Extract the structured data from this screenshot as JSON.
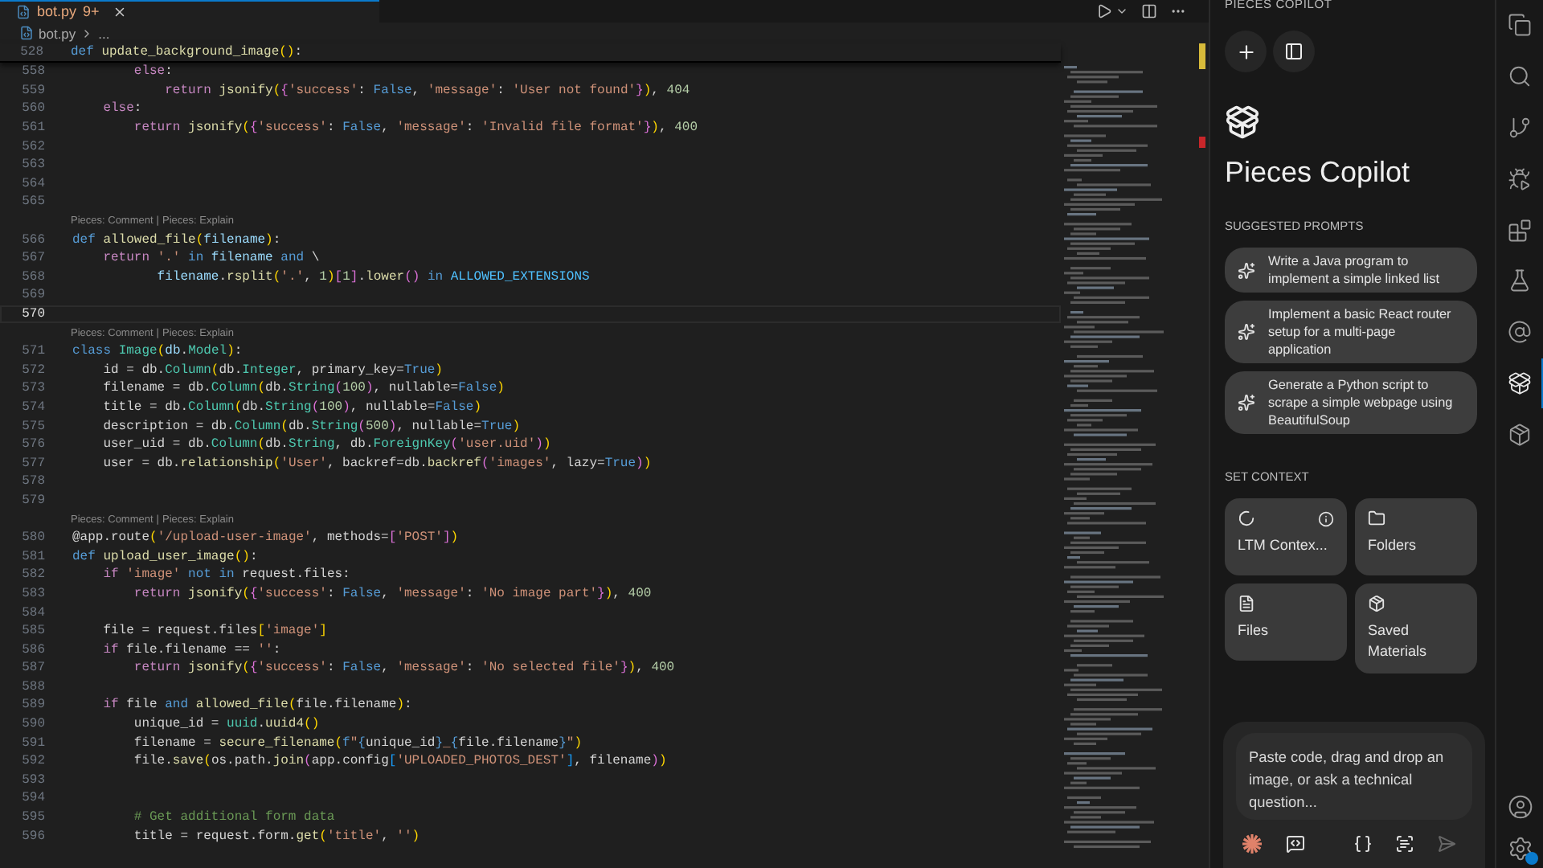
{
  "tab": {
    "label": "bot.py",
    "badge": "9+",
    "selected": true
  },
  "breadcrumb": {
    "file": "bot.py",
    "rest": "..."
  },
  "editor": {
    "sticky": {
      "number": "528",
      "tokens": [
        {
          "kind": "kw",
          "text": "def"
        },
        {
          "kind": "fn",
          "text": " update_background_image"
        },
        {
          "kind": "br",
          "text": "()"
        },
        {
          "kind": "p",
          "text": ":"
        }
      ]
    },
    "lines": [
      {
        "kind": "code",
        "number": "558",
        "current": false,
        "tokens": [
          {
            "kind": "ctl",
            "text": "        else"
          },
          {
            "kind": "p",
            "text": ":"
          }
        ]
      },
      {
        "kind": "code",
        "number": "559",
        "current": false,
        "tokens": [
          {
            "kind": "ctl",
            "text": "            return"
          },
          {
            "kind": "fn",
            "text": " jsonify"
          },
          {
            "kind": "br",
            "text": "("
          },
          {
            "kind": "br2",
            "text": "{"
          },
          {
            "kind": "str",
            "text": "'success'"
          },
          {
            "kind": "p",
            "text": ": "
          },
          {
            "kind": "kw",
            "text": "False"
          },
          {
            "kind": "p",
            "text": ", "
          },
          {
            "kind": "str",
            "text": "'message'"
          },
          {
            "kind": "p",
            "text": ": "
          },
          {
            "kind": "str",
            "text": "'User not found'"
          },
          {
            "kind": "br2",
            "text": "}"
          },
          {
            "kind": "br",
            "text": ")"
          },
          {
            "kind": "p",
            "text": ", "
          },
          {
            "kind": "num",
            "text": "404"
          }
        ]
      },
      {
        "kind": "code",
        "number": "560",
        "current": false,
        "tokens": [
          {
            "kind": "ctl",
            "text": "    else"
          },
          {
            "kind": "p",
            "text": ":"
          }
        ]
      },
      {
        "kind": "code",
        "number": "561",
        "current": false,
        "tokens": [
          {
            "kind": "ctl",
            "text": "        return"
          },
          {
            "kind": "fn",
            "text": " jsonify"
          },
          {
            "kind": "br",
            "text": "("
          },
          {
            "kind": "br2",
            "text": "{"
          },
          {
            "kind": "str",
            "text": "'success'"
          },
          {
            "kind": "p",
            "text": ": "
          },
          {
            "kind": "kw",
            "text": "False"
          },
          {
            "kind": "p",
            "text": ", "
          },
          {
            "kind": "str",
            "text": "'message'"
          },
          {
            "kind": "p",
            "text": ": "
          },
          {
            "kind": "str",
            "text": "'Invalid file format'"
          },
          {
            "kind": "br2",
            "text": "}"
          },
          {
            "kind": "br",
            "text": ")"
          },
          {
            "kind": "p",
            "text": ", "
          },
          {
            "kind": "num",
            "text": "400"
          }
        ]
      },
      {
        "kind": "code",
        "number": "562",
        "current": false
      },
      {
        "kind": "code",
        "number": "563",
        "current": false
      },
      {
        "kind": "code",
        "number": "564",
        "current": false
      },
      {
        "kind": "code",
        "number": "565",
        "current": false
      },
      {
        "kind": "lens",
        "links": [
          "Pieces: Comment",
          "Pieces: Explain"
        ],
        "separator": "|"
      },
      {
        "kind": "code",
        "number": "566",
        "current": false,
        "tokens": [
          {
            "kind": "kw",
            "text": "def"
          },
          {
            "kind": "fn",
            "text": " allowed_file"
          },
          {
            "kind": "br",
            "text": "("
          },
          {
            "kind": "var",
            "text": "filename"
          },
          {
            "kind": "br",
            "text": ")"
          },
          {
            "kind": "p",
            "text": ":"
          }
        ]
      },
      {
        "kind": "code",
        "number": "567",
        "current": false,
        "tokens": [
          {
            "kind": "ctl",
            "text": "    return"
          },
          {
            "kind": "str",
            "text": " '.'"
          },
          {
            "kind": "kw",
            "text": " in"
          },
          {
            "kind": "var",
            "text": " filename"
          },
          {
            "kind": "kw",
            "text": " and"
          },
          {
            "kind": "p",
            "text": " \\"
          }
        ]
      },
      {
        "kind": "code",
        "number": "568",
        "current": false,
        "tokens": [
          {
            "kind": "var",
            "text": "           filename"
          },
          {
            "kind": "p",
            "text": "."
          },
          {
            "kind": "fn",
            "text": "rsplit"
          },
          {
            "kind": "br",
            "text": "("
          },
          {
            "kind": "str",
            "text": "'.'"
          },
          {
            "kind": "p",
            "text": ", "
          },
          {
            "kind": "num",
            "text": "1"
          },
          {
            "kind": "br",
            "text": ")"
          },
          {
            "kind": "br2",
            "text": "["
          },
          {
            "kind": "num",
            "text": "1"
          },
          {
            "kind": "br2",
            "text": "]"
          },
          {
            "kind": "p",
            "text": "."
          },
          {
            "kind": "fn",
            "text": "lower"
          },
          {
            "kind": "br2",
            "text": "()"
          },
          {
            "kind": "kw",
            "text": " in"
          },
          {
            "kind": "cst",
            "text": " ALLOWED_EXTENSIONS"
          }
        ]
      },
      {
        "kind": "code",
        "number": "569",
        "current": false
      },
      {
        "kind": "code",
        "number": "570",
        "current": true
      },
      {
        "kind": "lens",
        "links": [
          "Pieces: Comment",
          "Pieces: Explain"
        ],
        "separator": "|"
      },
      {
        "kind": "code",
        "number": "571",
        "current": false,
        "tokens": [
          {
            "kind": "kw",
            "text": "class"
          },
          {
            "kind": "cls",
            "text": " Image"
          },
          {
            "kind": "br",
            "text": "("
          },
          {
            "kind": "var",
            "text": "db"
          },
          {
            "kind": "p",
            "text": "."
          },
          {
            "kind": "cls",
            "text": "Model"
          },
          {
            "kind": "br",
            "text": ")"
          },
          {
            "kind": "p",
            "text": ":"
          }
        ]
      },
      {
        "kind": "code",
        "number": "572",
        "current": false,
        "tokens": [
          {
            "kind": "p",
            "text": "    id = db."
          },
          {
            "kind": "cls",
            "text": "Column"
          },
          {
            "kind": "br",
            "text": "("
          },
          {
            "kind": "p",
            "text": "db."
          },
          {
            "kind": "cls",
            "text": "Integer"
          },
          {
            "kind": "p",
            "text": ", primary_key="
          },
          {
            "kind": "kw",
            "text": "True"
          },
          {
            "kind": "br",
            "text": ")"
          }
        ]
      },
      {
        "kind": "code",
        "number": "573",
        "current": false,
        "tokens": [
          {
            "kind": "p",
            "text": "    filename = db."
          },
          {
            "kind": "cls",
            "text": "Column"
          },
          {
            "kind": "br",
            "text": "("
          },
          {
            "kind": "p",
            "text": "db."
          },
          {
            "kind": "cls",
            "text": "String"
          },
          {
            "kind": "br2",
            "text": "("
          },
          {
            "kind": "num",
            "text": "100"
          },
          {
            "kind": "br2",
            "text": ")"
          },
          {
            "kind": "p",
            "text": ", nullable="
          },
          {
            "kind": "kw",
            "text": "False"
          },
          {
            "kind": "br",
            "text": ")"
          }
        ]
      },
      {
        "kind": "code",
        "number": "574",
        "current": false,
        "tokens": [
          {
            "kind": "p",
            "text": "    title = db."
          },
          {
            "kind": "cls",
            "text": "Column"
          },
          {
            "kind": "br",
            "text": "("
          },
          {
            "kind": "p",
            "text": "db."
          },
          {
            "kind": "cls",
            "text": "String"
          },
          {
            "kind": "br2",
            "text": "("
          },
          {
            "kind": "num",
            "text": "100"
          },
          {
            "kind": "br2",
            "text": ")"
          },
          {
            "kind": "p",
            "text": ", nullable="
          },
          {
            "kind": "kw",
            "text": "False"
          },
          {
            "kind": "br",
            "text": ")"
          }
        ]
      },
      {
        "kind": "code",
        "number": "575",
        "current": false,
        "tokens": [
          {
            "kind": "p",
            "text": "    description = db."
          },
          {
            "kind": "cls",
            "text": "Column"
          },
          {
            "kind": "br",
            "text": "("
          },
          {
            "kind": "p",
            "text": "db."
          },
          {
            "kind": "cls",
            "text": "String"
          },
          {
            "kind": "br2",
            "text": "("
          },
          {
            "kind": "num",
            "text": "500"
          },
          {
            "kind": "br2",
            "text": ")"
          },
          {
            "kind": "p",
            "text": ", nullable="
          },
          {
            "kind": "kw",
            "text": "True"
          },
          {
            "kind": "br",
            "text": ")"
          }
        ]
      },
      {
        "kind": "code",
        "number": "576",
        "current": false,
        "tokens": [
          {
            "kind": "p",
            "text": "    user_uid = db."
          },
          {
            "kind": "cls",
            "text": "Column"
          },
          {
            "kind": "br",
            "text": "("
          },
          {
            "kind": "p",
            "text": "db."
          },
          {
            "kind": "cls",
            "text": "String"
          },
          {
            "kind": "p",
            "text": ", db."
          },
          {
            "kind": "cls",
            "text": "ForeignKey"
          },
          {
            "kind": "br2",
            "text": "("
          },
          {
            "kind": "str",
            "text": "'user.uid'"
          },
          {
            "kind": "br2",
            "text": ")"
          },
          {
            "kind": "br",
            "text": ")"
          }
        ]
      },
      {
        "kind": "code",
        "number": "577",
        "current": false,
        "tokens": [
          {
            "kind": "p",
            "text": "    user = db."
          },
          {
            "kind": "fn",
            "text": "relationship"
          },
          {
            "kind": "br",
            "text": "("
          },
          {
            "kind": "str",
            "text": "'User'"
          },
          {
            "kind": "p",
            "text": ", backref=db."
          },
          {
            "kind": "fn",
            "text": "backref"
          },
          {
            "kind": "br2",
            "text": "("
          },
          {
            "kind": "str",
            "text": "'images'"
          },
          {
            "kind": "p",
            "text": ", lazy="
          },
          {
            "kind": "kw",
            "text": "True"
          },
          {
            "kind": "br2",
            "text": ")"
          },
          {
            "kind": "br",
            "text": ")"
          }
        ]
      },
      {
        "kind": "code",
        "number": "578",
        "current": false
      },
      {
        "kind": "code",
        "number": "579",
        "current": false
      },
      {
        "kind": "lens",
        "links": [
          "Pieces: Comment",
          "Pieces: Explain"
        ],
        "separator": "|"
      },
      {
        "kind": "code",
        "number": "580",
        "current": false,
        "tokens": [
          {
            "kind": "p",
            "text": "@app.route"
          },
          {
            "kind": "br",
            "text": "("
          },
          {
            "kind": "str",
            "text": "'/upload-user-image'"
          },
          {
            "kind": "p",
            "text": ", methods="
          },
          {
            "kind": "br2",
            "text": "["
          },
          {
            "kind": "str",
            "text": "'POST'"
          },
          {
            "kind": "br2",
            "text": "]"
          },
          {
            "kind": "br",
            "text": ")"
          }
        ]
      },
      {
        "kind": "code",
        "number": "581",
        "current": false,
        "tokens": [
          {
            "kind": "kw",
            "text": "def"
          },
          {
            "kind": "fn",
            "text": " upload_user_image"
          },
          {
            "kind": "br",
            "text": "()"
          },
          {
            "kind": "p",
            "text": ":"
          }
        ]
      },
      {
        "kind": "code",
        "number": "582",
        "current": false,
        "tokens": [
          {
            "kind": "ctl",
            "text": "    if"
          },
          {
            "kind": "str",
            "text": " 'image'"
          },
          {
            "kind": "kw",
            "text": " not in"
          },
          {
            "kind": "p",
            "text": " request.files:"
          }
        ]
      },
      {
        "kind": "code",
        "number": "583",
        "current": false,
        "tokens": [
          {
            "kind": "ctl",
            "text": "        return"
          },
          {
            "kind": "fn",
            "text": " jsonify"
          },
          {
            "kind": "br",
            "text": "("
          },
          {
            "kind": "br2",
            "text": "{"
          },
          {
            "kind": "str",
            "text": "'success'"
          },
          {
            "kind": "p",
            "text": ": "
          },
          {
            "kind": "kw",
            "text": "False"
          },
          {
            "kind": "p",
            "text": ", "
          },
          {
            "kind": "str",
            "text": "'message'"
          },
          {
            "kind": "p",
            "text": ": "
          },
          {
            "kind": "str",
            "text": "'No image part'"
          },
          {
            "kind": "br2",
            "text": "}"
          },
          {
            "kind": "br",
            "text": ")"
          },
          {
            "kind": "p",
            "text": ", "
          },
          {
            "kind": "num",
            "text": "400"
          }
        ]
      },
      {
        "kind": "code",
        "number": "584",
        "current": false
      },
      {
        "kind": "code",
        "number": "585",
        "current": false,
        "tokens": [
          {
            "kind": "p",
            "text": "    file = request.files"
          },
          {
            "kind": "br",
            "text": "["
          },
          {
            "kind": "str",
            "text": "'image'"
          },
          {
            "kind": "br",
            "text": "]"
          }
        ]
      },
      {
        "kind": "code",
        "number": "586",
        "current": false,
        "tokens": [
          {
            "kind": "ctl",
            "text": "    if"
          },
          {
            "kind": "p",
            "text": " file.filename == "
          },
          {
            "kind": "str",
            "text": "''"
          },
          {
            "kind": "p",
            "text": ":"
          }
        ]
      },
      {
        "kind": "code",
        "number": "587",
        "current": false,
        "tokens": [
          {
            "kind": "ctl",
            "text": "        return"
          },
          {
            "kind": "fn",
            "text": " jsonify"
          },
          {
            "kind": "br",
            "text": "("
          },
          {
            "kind": "br2",
            "text": "{"
          },
          {
            "kind": "str",
            "text": "'success'"
          },
          {
            "kind": "p",
            "text": ": "
          },
          {
            "kind": "kw",
            "text": "False"
          },
          {
            "kind": "p",
            "text": ", "
          },
          {
            "kind": "str",
            "text": "'message'"
          },
          {
            "kind": "p",
            "text": ": "
          },
          {
            "kind": "str",
            "text": "'No selected file'"
          },
          {
            "kind": "br2",
            "text": "}"
          },
          {
            "kind": "br",
            "text": ")"
          },
          {
            "kind": "p",
            "text": ", "
          },
          {
            "kind": "num",
            "text": "400"
          }
        ]
      },
      {
        "kind": "code",
        "number": "588",
        "current": false
      },
      {
        "kind": "code",
        "number": "589",
        "current": false,
        "tokens": [
          {
            "kind": "ctl",
            "text": "    if"
          },
          {
            "kind": "p",
            "text": " file "
          },
          {
            "kind": "kw",
            "text": "and"
          },
          {
            "kind": "fn",
            "text": " allowed_file"
          },
          {
            "kind": "br",
            "text": "("
          },
          {
            "kind": "p",
            "text": "file.filename"
          },
          {
            "kind": "br",
            "text": ")"
          },
          {
            "kind": "p",
            "text": ":"
          }
        ]
      },
      {
        "kind": "code",
        "number": "590",
        "current": false,
        "tokens": [
          {
            "kind": "p",
            "text": "        unique_id = "
          },
          {
            "kind": "cls",
            "text": "uuid"
          },
          {
            "kind": "p",
            "text": "."
          },
          {
            "kind": "fn",
            "text": "uuid4"
          },
          {
            "kind": "br",
            "text": "()"
          }
        ]
      },
      {
        "kind": "code",
        "number": "591",
        "current": false,
        "tokens": [
          {
            "kind": "p",
            "text": "        filename = "
          },
          {
            "kind": "fn",
            "text": "secure_filename"
          },
          {
            "kind": "br",
            "text": "("
          },
          {
            "kind": "kw",
            "text": "f"
          },
          {
            "kind": "str",
            "text": "\""
          },
          {
            "kind": "kw",
            "text": "{"
          },
          {
            "kind": "p",
            "text": "unique_id"
          },
          {
            "kind": "kw",
            "text": "}"
          },
          {
            "kind": "str",
            "text": "_"
          },
          {
            "kind": "kw",
            "text": "{"
          },
          {
            "kind": "p",
            "text": "file.filename"
          },
          {
            "kind": "kw",
            "text": "}"
          },
          {
            "kind": "str",
            "text": "\""
          },
          {
            "kind": "br",
            "text": ")"
          }
        ]
      },
      {
        "kind": "code",
        "number": "592",
        "current": false,
        "tokens": [
          {
            "kind": "p",
            "text": "        file."
          },
          {
            "kind": "fn",
            "text": "save"
          },
          {
            "kind": "br",
            "text": "("
          },
          {
            "kind": "p",
            "text": "os.path."
          },
          {
            "kind": "fn",
            "text": "join"
          },
          {
            "kind": "br2",
            "text": "("
          },
          {
            "kind": "p",
            "text": "app.config"
          },
          {
            "kind": "br3",
            "text": "["
          },
          {
            "kind": "str",
            "text": "'UPLOADED_PHOTOS_DEST'"
          },
          {
            "kind": "br3",
            "text": "]"
          },
          {
            "kind": "p",
            "text": ", filename"
          },
          {
            "kind": "br2",
            "text": ")"
          },
          {
            "kind": "br",
            "text": ")"
          }
        ]
      },
      {
        "kind": "code",
        "number": "593",
        "current": false
      },
      {
        "kind": "code",
        "number": "594",
        "current": false
      },
      {
        "kind": "code",
        "number": "595",
        "current": false,
        "tokens": [
          {
            "kind": "cmt",
            "text": "        # Get additional form data"
          }
        ]
      },
      {
        "kind": "code",
        "number": "596",
        "current": false,
        "tokens": [
          {
            "kind": "p",
            "text": "        title = request.form."
          },
          {
            "kind": "fn",
            "text": "get"
          },
          {
            "kind": "br",
            "text": "("
          },
          {
            "kind": "str",
            "text": "'title'"
          },
          {
            "kind": "p",
            "text": ", "
          },
          {
            "kind": "str",
            "text": "''"
          },
          {
            "kind": "br",
            "text": ")"
          }
        ]
      }
    ]
  },
  "copilot": {
    "header": "PIECES COPILOT",
    "title": "Pieces Copilot",
    "prompts_heading": "SUGGESTED PROMPTS",
    "prompts": [
      "Write a Java program to implement a simple linked list",
      "Implement a basic React router setup for a multi-page application",
      "Generate a Python script to scrape a simple webpage using BeautifulSoup"
    ],
    "context_heading": "SET CONTEXT",
    "context": [
      {
        "label": "LTM Contex...",
        "info": true
      },
      {
        "label": "Folders",
        "info": false
      },
      {
        "label": "Files",
        "info": false
      },
      {
        "label": "Saved Materials",
        "info": false
      }
    ],
    "composer": {
      "placeholder": "Paste code, drag and drop an image, or ask a technical question...",
      "send_disabled": true
    }
  },
  "activity_bar": [
    {
      "selected": false
    },
    {
      "selected": false
    },
    {
      "selected": false
    },
    {
      "selected": false
    },
    {
      "selected": false
    },
    {
      "selected": false
    },
    {
      "selected": false
    },
    {
      "selected": true
    },
    {
      "selected": false
    }
  ]
}
